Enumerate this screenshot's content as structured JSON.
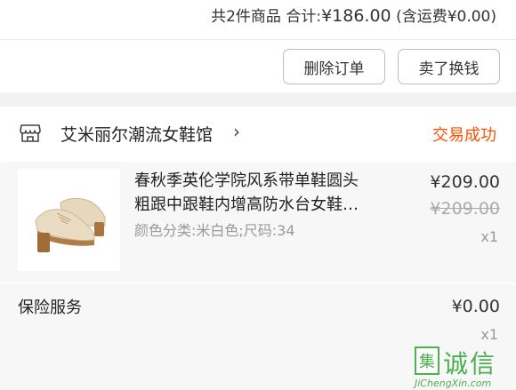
{
  "summary": {
    "count_text": "共2件商品",
    "total_label": "合计:",
    "total_amount": "¥186.00",
    "shipping_note": "(含运费¥0.00)"
  },
  "actions": {
    "delete_order": "删除订单",
    "sell_resell": "卖了换钱"
  },
  "shop": {
    "icon": "shop-icon",
    "name": "艾米丽尔潮流女鞋馆",
    "chevron": "›",
    "status": "交易成功",
    "status_color": "#ff5000"
  },
  "product": {
    "title_line1": "春秋季英伦学院风系带单鞋圆头",
    "title_line2": "粗跟中跟鞋内增高防水台女鞋…",
    "sku": "颜色分类:米白色;尺码:34",
    "price": "¥209.00",
    "original_price": "¥209.00",
    "quantity": "x1",
    "image": "beige-lace-up-platform-shoe"
  },
  "insurance": {
    "label": "保险服务",
    "price": "¥0.00",
    "quantity": "x1"
  },
  "watermark": {
    "box_char": "集",
    "chars": "诚信",
    "url": "JiChengXin.com",
    "color": "#4caf50"
  }
}
